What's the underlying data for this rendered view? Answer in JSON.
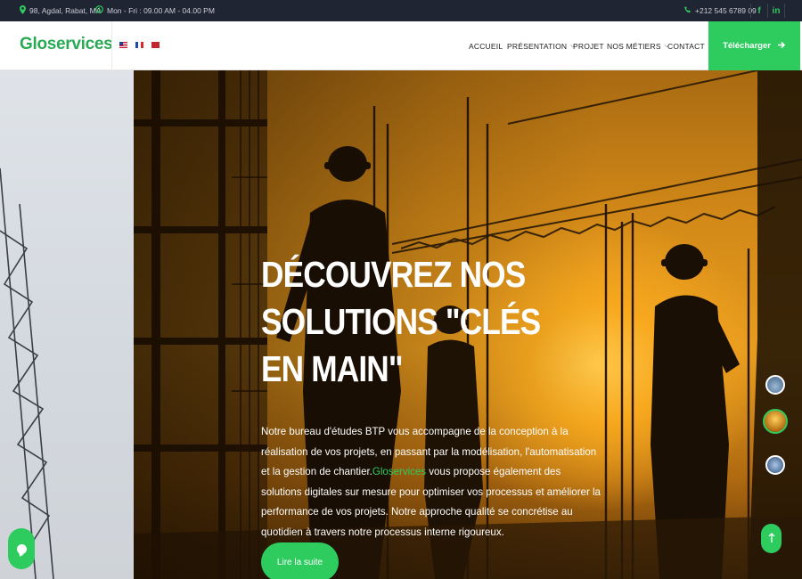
{
  "topbar": {
    "address": "98, Agdal, Rabat, MA",
    "address_icon": "map-pin-icon",
    "hours": "Mon - Fri : 09.00 AM - 04.00 PM",
    "hours_icon": "clock-icon",
    "phone": "+212 545 6789 09",
    "phone_icon": "phone-icon",
    "social": [
      {
        "icon": "facebook-icon",
        "glyph": "f"
      },
      {
        "icon": "linkedin-icon",
        "glyph": "in"
      }
    ]
  },
  "header": {
    "logo": "Gloservices",
    "languages": [
      "English",
      "Français",
      "العربية"
    ],
    "nav": [
      {
        "label": "ACCUEIL",
        "dropdown": false
      },
      {
        "label": "PRÉSENTATION",
        "dropdown": true
      },
      {
        "label": "PROJET",
        "dropdown": false
      },
      {
        "label": "NOS MÉTIERS",
        "dropdown": true
      },
      {
        "label": "CONTACT",
        "dropdown": false
      }
    ],
    "download_label": "Télécharger",
    "download_icon": "arrow-right-icon"
  },
  "hero": {
    "title": "DÉCOUVREZ NOS SOLUTIONS \"CLÉS EN MAIN\"",
    "text_before": "Notre bureau d'études BTP vous accompagne de la conception à la réalisation de vos projets, en passant par la modélisation, l'automatisation et la gestion de chantier.",
    "brand": "Gloservices",
    "text_after": " vous propose également des solutions digitales sur mesure pour optimiser vos processus et améliorer la performance de vos projets. Notre approche qualité se concrétise au quotidien à travers notre processus interne rigoureux.",
    "cta_label": "Lire la suite"
  },
  "slider": {
    "active_index": 1,
    "count": 3
  },
  "floating": {
    "scroll_top_icon": "arrow-up-icon",
    "chat_icon": "chat-bubble-icon"
  },
  "colors": {
    "accent": "#2ecc5f",
    "topbar_bg": "#1f2533"
  }
}
